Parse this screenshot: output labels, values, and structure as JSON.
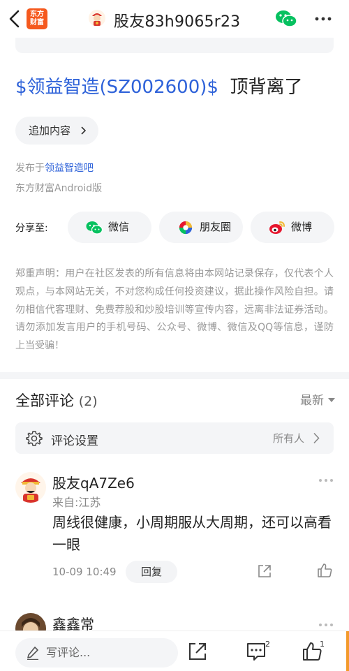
{
  "header": {
    "app_logo_text": [
      "东方",
      "财富"
    ],
    "title": "股友83h9065r23",
    "back_icon": "chevron-left-icon",
    "share_icon": "wechat-icon",
    "more_icon": "more-dots-icon"
  },
  "post": {
    "stock_tag": "$领益智造(SZ002600)$",
    "content": "顶背离了",
    "add_content_label": "追加内容",
    "published_prefix": "发布于",
    "published_bar": "领益智造吧",
    "source": "东方财富Android版"
  },
  "share": {
    "label": "分享至:",
    "targets": [
      {
        "label": "微信",
        "icon": "wechat-icon"
      },
      {
        "label": "朋友圈",
        "icon": "moments-icon"
      },
      {
        "label": "微博",
        "icon": "weibo-icon"
      }
    ]
  },
  "disclaimer": "郑重声明：用户在社区发表的所有信息将由本网站记录保存，仅代表个人观点，与本网站无关，不对您构成任何投资建议，据此操作风险自担。请勿相信代客理财、免费荐股和炒股培训等宣传内容，远离非法证券活动。请勿添加发言用户的手机号码、公众号、微博、微信及QQ等信息，谨防上当受骗！",
  "comments": {
    "heading": "全部评论",
    "count": "(2)",
    "sort": "最新",
    "settings_label": "评论设置",
    "settings_value": "所有人",
    "items": [
      {
        "name": "股友qA7Ze6",
        "location": "来自:江苏",
        "text": "周线很健康，小周期服从大周期，还可以高看一眼",
        "time": "10-09 10:49",
        "reply_label": "回复"
      },
      {
        "name": "鑫鑫常"
      }
    ]
  },
  "bottom_bar": {
    "write_placeholder": "写评论...",
    "comment_badge": "2",
    "like_badge": "1"
  },
  "colors": {
    "accent_blue": "#2e62d9",
    "brand_orange": "#f5591e",
    "wechat_green": "#07c160",
    "weibo_red": "#e6162d"
  }
}
